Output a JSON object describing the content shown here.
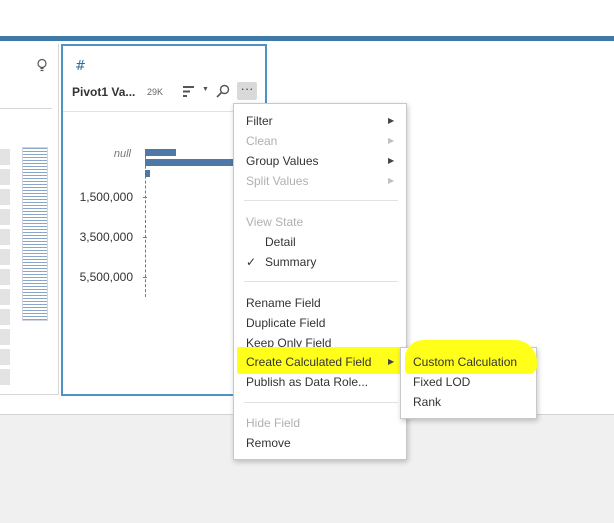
{
  "profile_card": {
    "type_icon": "#",
    "title": "Pivot1 Va...",
    "count": "29K",
    "null_label": "null",
    "axis_labels": [
      "1,500,000",
      "3,500,000",
      "5,500,000"
    ]
  },
  "context_menu": {
    "items": [
      {
        "label": "Filter",
        "submenu": true,
        "enabled": true
      },
      {
        "label": "Clean",
        "submenu": true,
        "enabled": false
      },
      {
        "label": "Group Values",
        "submenu": true,
        "enabled": true
      },
      {
        "label": "Split Values",
        "submenu": true,
        "enabled": false
      }
    ],
    "view_state_header": "View State",
    "view_state_options": [
      {
        "label": "Detail",
        "checked": false
      },
      {
        "label": "Summary",
        "checked": true
      }
    ],
    "check_mark": "✓",
    "field_actions": [
      {
        "label": "Rename Field",
        "submenu": false,
        "enabled": true
      },
      {
        "label": "Duplicate Field",
        "submenu": false,
        "enabled": true
      },
      {
        "label": "Keep Only Field",
        "submenu": false,
        "enabled": true
      },
      {
        "label": "Create Calculated Field",
        "submenu": true,
        "enabled": true,
        "highlighted": true
      },
      {
        "label": "Publish as Data Role...",
        "submenu": false,
        "enabled": true
      }
    ],
    "hide_field": "Hide Field",
    "remove": "Remove"
  },
  "submenu": {
    "items": [
      {
        "label": "Custom Calculation",
        "highlighted": true
      },
      {
        "label": "Fixed LOD"
      },
      {
        "label": "Rank"
      }
    ]
  },
  "colors": {
    "accent": "#3f79a8",
    "bar": "#4e79a7",
    "highlight": "#ffff1a",
    "card_border": "#4f92c4"
  },
  "icons": [
    "lightbulb-icon",
    "number-type-icon",
    "sort-icon",
    "search-icon",
    "more-icon",
    "submenu-arrow-icon",
    "check-icon"
  ]
}
